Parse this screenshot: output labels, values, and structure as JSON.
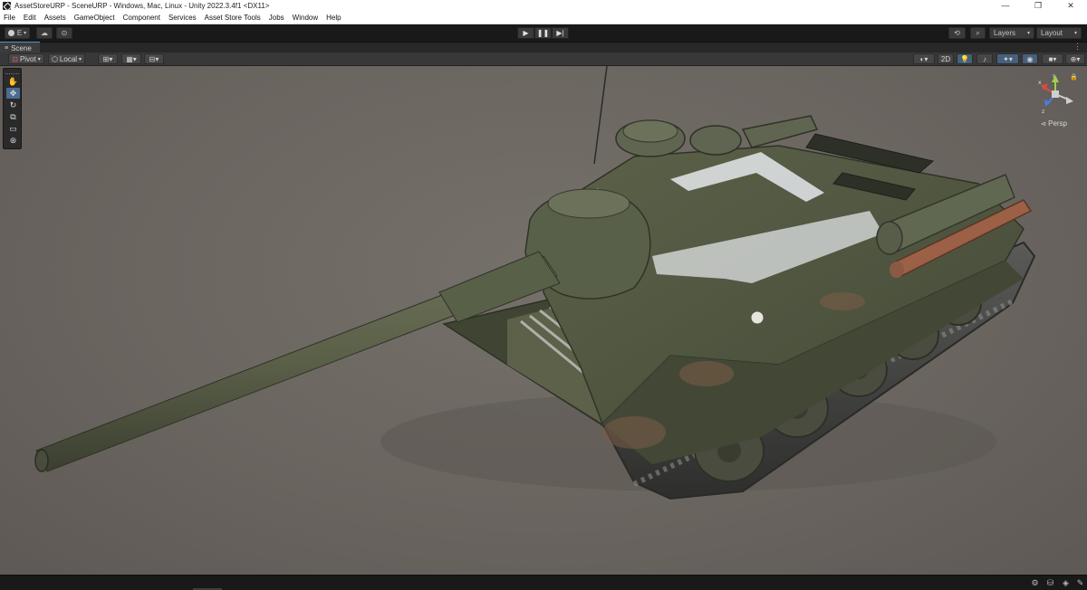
{
  "window": {
    "title": "AssetStoreURP - SceneURP - Windows, Mac, Linux - Unity 2022.3.4f1 <DX11>",
    "controls": [
      "—",
      "❐",
      "✕"
    ]
  },
  "menu": [
    "File",
    "Edit",
    "Assets",
    "GameObject",
    "Component",
    "Services",
    "Asset Store Tools",
    "Jobs",
    "Window",
    "Help"
  ],
  "toolbar": {
    "account_label": "E",
    "layers_label": "Layers",
    "layout_label": "Layout"
  },
  "scene": {
    "tab_label": "Scene",
    "pivot_label": "Pivot",
    "local_label": "Local",
    "mode_2d_label": "2D",
    "persp_label": "Persp"
  },
  "colors": {
    "accent": "#4e90d0",
    "viewport_bg": "#6b6560",
    "tank_body": "#4f5541",
    "tank_dark": "#3e4433",
    "snow": "#d9dde0",
    "rust": "#8a5a44"
  },
  "icons": {
    "tools": [
      "hand-icon",
      "move-icon",
      "rotate-icon",
      "scale-icon",
      "rect-icon",
      "transform-icon"
    ]
  }
}
